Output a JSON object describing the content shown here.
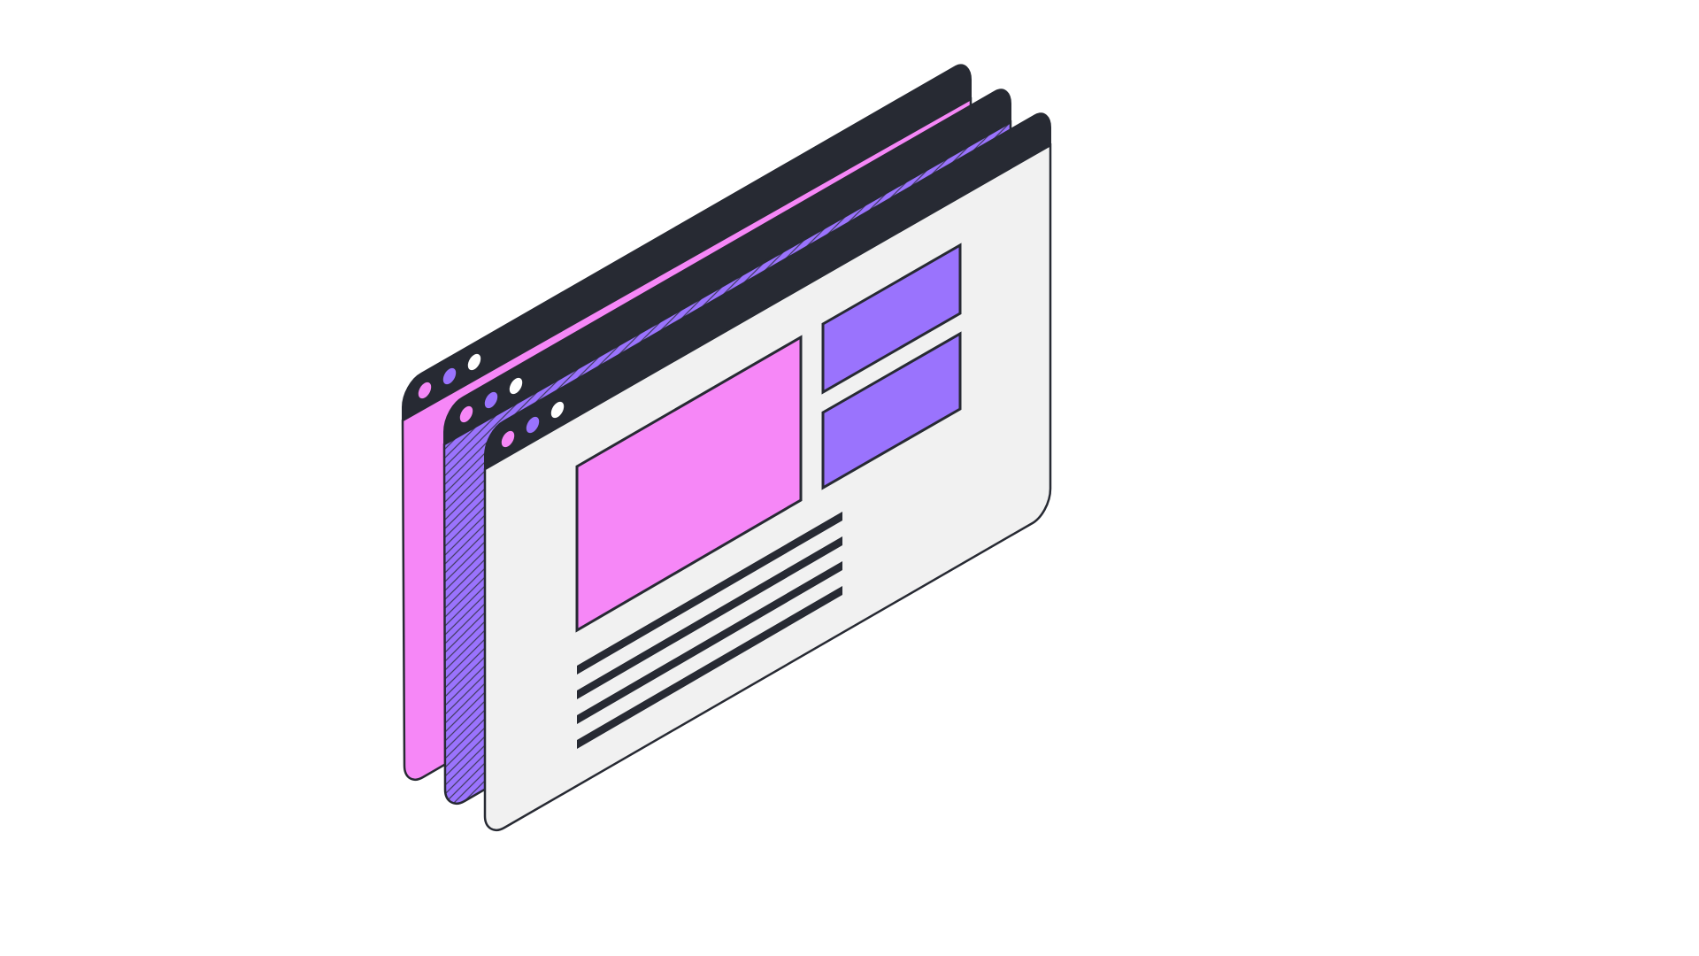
{
  "illustration": {
    "subject": "stacked-browser-windows",
    "colors": {
      "background": "#ffffff",
      "titlebar": "#272a33",
      "outline": "#272a33",
      "pink": "#f687f7",
      "purple": "#9a73fd",
      "page": "#f1f1f1",
      "dot_white": "#ffffff"
    },
    "windows": [
      {
        "name": "back-window",
        "fill": "pink",
        "pattern": "solid"
      },
      {
        "name": "middle-window",
        "fill": "purple",
        "pattern": "hatched"
      },
      {
        "name": "front-window",
        "fill": "page",
        "pattern": "solid"
      }
    ],
    "front_window_content": {
      "image_block_color": "pink",
      "side_card_color": "purple",
      "side_card_count": 2,
      "text_line_count": 4
    }
  }
}
